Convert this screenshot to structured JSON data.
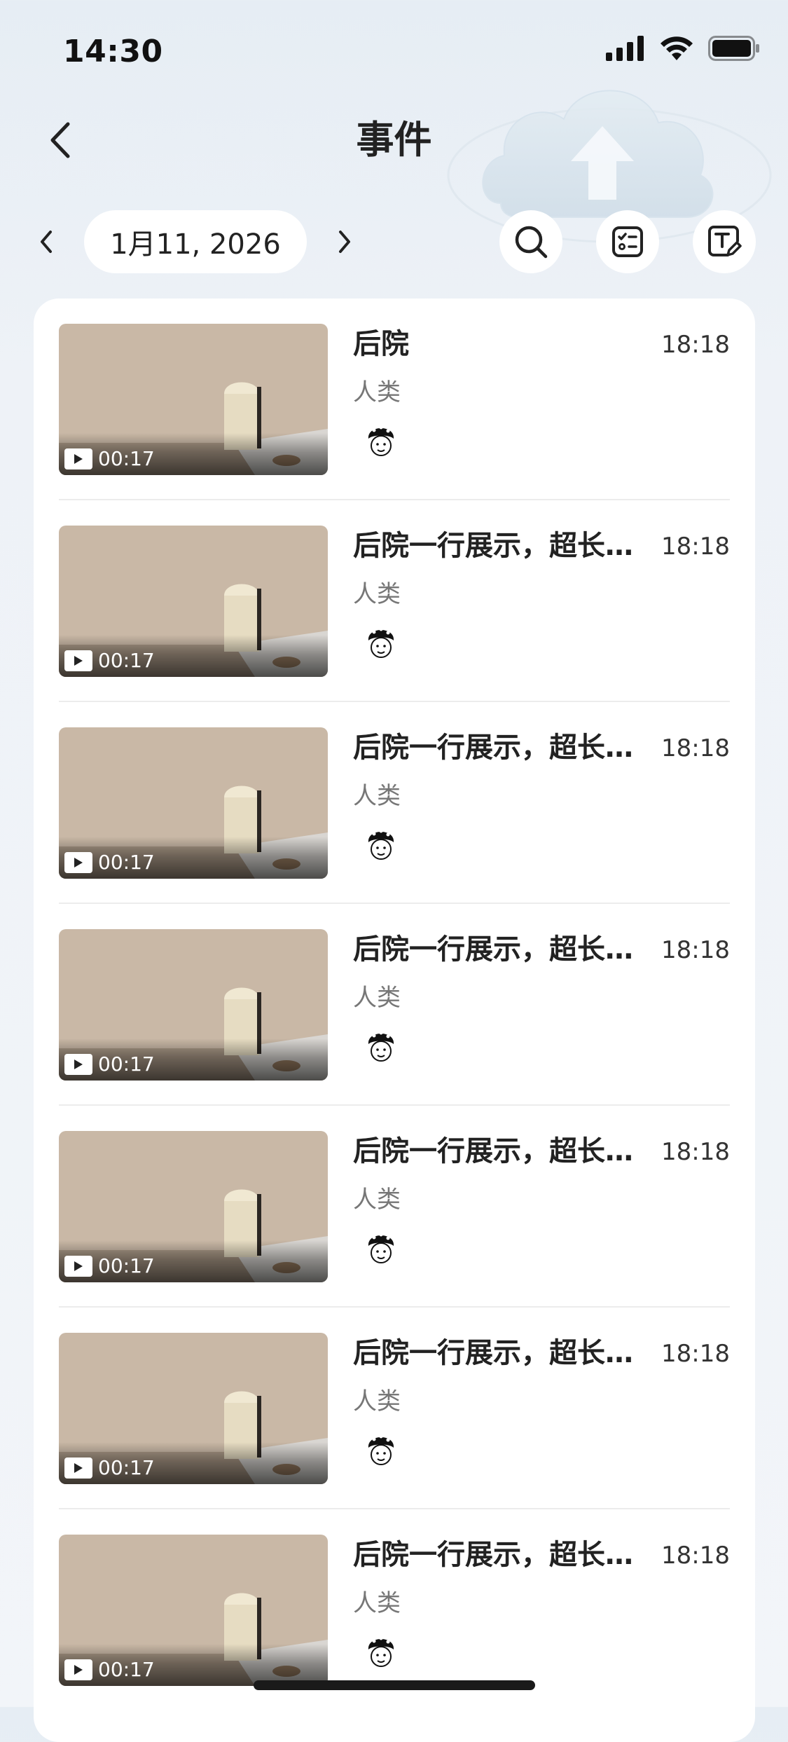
{
  "status_bar": {
    "time": "14:30",
    "icons": [
      "signal-icon",
      "wifi-icon",
      "battery-icon"
    ]
  },
  "header": {
    "back_icon": "chevron-left-icon",
    "title": "事件"
  },
  "date_nav": {
    "prev_icon": "chevron-left-icon",
    "date": "1月11, 2026",
    "next_icon": "chevron-right-icon"
  },
  "toolbar": {
    "buttons": [
      "search-icon",
      "filter-list-icon",
      "edit-text-icon"
    ]
  },
  "events": [
    {
      "title": "后院",
      "time": "18:18",
      "tag": "人类",
      "duration": "00:17"
    },
    {
      "title": "后院一行展示，超长…",
      "time": "18:18",
      "tag": "人类",
      "duration": "00:17"
    },
    {
      "title": "后院一行展示，超长…",
      "time": "18:18",
      "tag": "人类",
      "duration": "00:17"
    },
    {
      "title": "后院一行展示，超长…",
      "time": "18:18",
      "tag": "人类",
      "duration": "00:17"
    },
    {
      "title": "后院一行展示，超长…",
      "time": "18:18",
      "tag": "人类",
      "duration": "00:17"
    },
    {
      "title": "后院一行展示，超长…",
      "time": "18:18",
      "tag": "人类",
      "duration": "00:17"
    },
    {
      "title": "后院一行展示，超长…",
      "time": "18:18",
      "tag": "人类",
      "duration": "00:17"
    }
  ],
  "colors": {
    "background": "#eef2f7",
    "card": "#ffffff",
    "text_primary": "#222222",
    "text_secondary": "#777777",
    "thumbnail_wall": "#c9b8a6"
  }
}
